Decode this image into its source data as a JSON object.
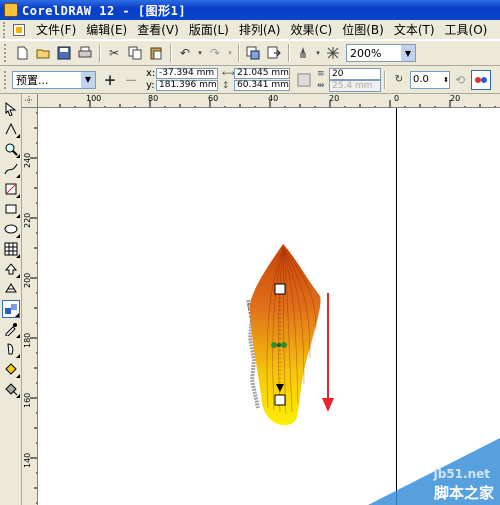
{
  "window": {
    "title": "CorelDRAW 12 - [图形1]"
  },
  "menu": {
    "items": [
      {
        "label": "文件(F)"
      },
      {
        "label": "编辑(E)"
      },
      {
        "label": "查看(V)"
      },
      {
        "label": "版面(L)"
      },
      {
        "label": "排列(A)"
      },
      {
        "label": "效果(C)"
      },
      {
        "label": "位图(B)"
      },
      {
        "label": "文本(T)"
      },
      {
        "label": "工具(O)"
      }
    ]
  },
  "toolbar": {
    "zoom": "200%"
  },
  "property_bar": {
    "preset": "预置...",
    "x_label": "x:",
    "x_value": "-37.394 mm",
    "y_label": "y:",
    "y_value": "181.396 mm",
    "width": "21.045 mm",
    "height": "60.341 mm",
    "steps": "20",
    "offset": "25.4 mm",
    "angle": "0.0"
  },
  "rulers": {
    "horizontal": [
      "100",
      "80",
      "60",
      "40",
      "20",
      "0",
      "20"
    ],
    "vertical": [
      "240",
      "220",
      "200",
      "180",
      "160",
      "140"
    ]
  },
  "watermark": {
    "url": "jb51.net",
    "name": "脚本之家"
  },
  "colors": {
    "title_bar": "#0a3fc9",
    "chrome": "#ece9d8",
    "blend_top": "#c8420a",
    "blend_bottom": "#ffee00",
    "arrow": "#e8262b"
  }
}
